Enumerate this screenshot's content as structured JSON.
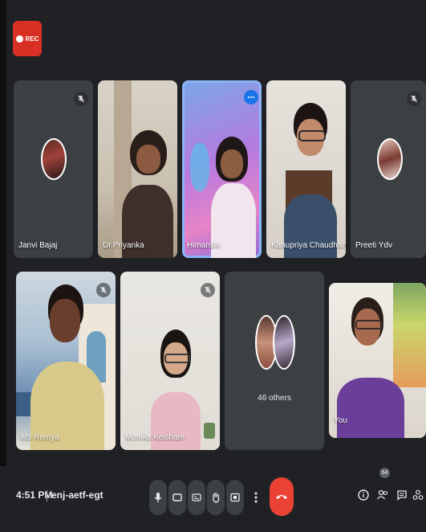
{
  "recording": {
    "label": "REC",
    "color": "#d93025"
  },
  "participants": [
    {
      "name": "Janvi Bajaj",
      "muted": true
    },
    {
      "name": "Dr.Priyanka",
      "muted": false
    },
    {
      "name": "Himanshi",
      "muted": false,
      "speaking": true
    },
    {
      "name": "Kanupriya Chaudhary",
      "muted": false
    },
    {
      "name": "Preeti Ydv",
      "muted": true
    },
    {
      "name": "Ms Remya",
      "muted": true
    },
    {
      "name": "Monika Keisham",
      "muted": true
    },
    {
      "name": "46 others",
      "muted": false
    },
    {
      "name": "You",
      "muted": false
    }
  ],
  "bottom_bar": {
    "time": "4:51 PM",
    "meeting_code": "enj-aetf-egt",
    "people_count": "54",
    "controls": [
      "mic-icon",
      "camera-icon",
      "captions-icon",
      "raise-hand-icon",
      "present-icon",
      "more-options-icon"
    ],
    "end_call_color": "#ea4335"
  },
  "colors": {
    "background": "#202124",
    "tile": "#3c4043",
    "active_outline": "#8ab4f8"
  }
}
